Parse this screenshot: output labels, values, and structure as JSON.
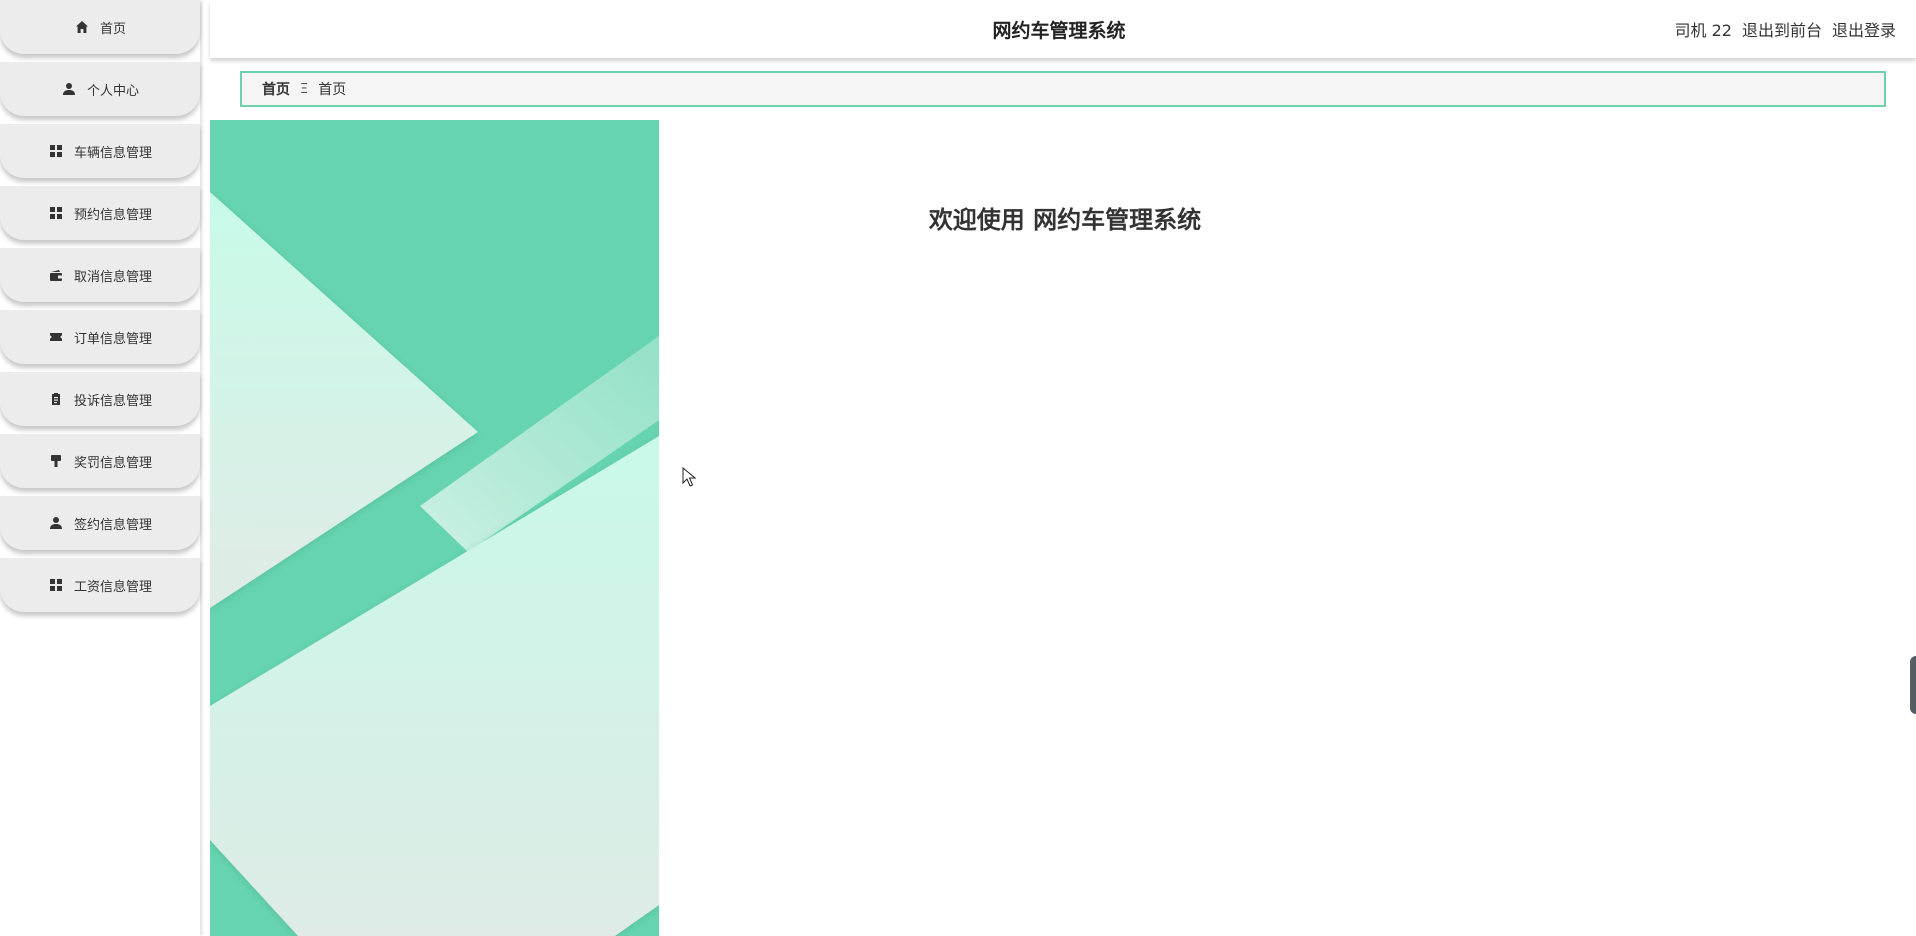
{
  "app": {
    "title": "网约车管理系统"
  },
  "header": {
    "user_label": "司机 22",
    "front_link": "退出到前台",
    "logout_link": "退出登录"
  },
  "sidebar": {
    "items": [
      {
        "label": "首页",
        "icon": "home-icon"
      },
      {
        "label": "个人中心",
        "icon": "user-icon"
      },
      {
        "label": "车辆信息管理",
        "icon": "grid-icon"
      },
      {
        "label": "预约信息管理",
        "icon": "grid-icon"
      },
      {
        "label": "取消信息管理",
        "icon": "wallet-icon"
      },
      {
        "label": "订单信息管理",
        "icon": "ticket-icon"
      },
      {
        "label": "投诉信息管理",
        "icon": "clipboard-icon"
      },
      {
        "label": "奖罚信息管理",
        "icon": "brush-icon"
      },
      {
        "label": "签约信息管理",
        "icon": "user-icon"
      },
      {
        "label": "工资信息管理",
        "icon": "grid-icon"
      }
    ]
  },
  "breadcrumb": {
    "home": "首页",
    "separator": "Ξ",
    "current": "首页"
  },
  "main": {
    "welcome": "欢迎使用 网约车管理系统"
  },
  "colors": {
    "accent": "#6fd1ac",
    "banner_teal": "#67d4b1",
    "banner_light": "#d6f3ea"
  }
}
